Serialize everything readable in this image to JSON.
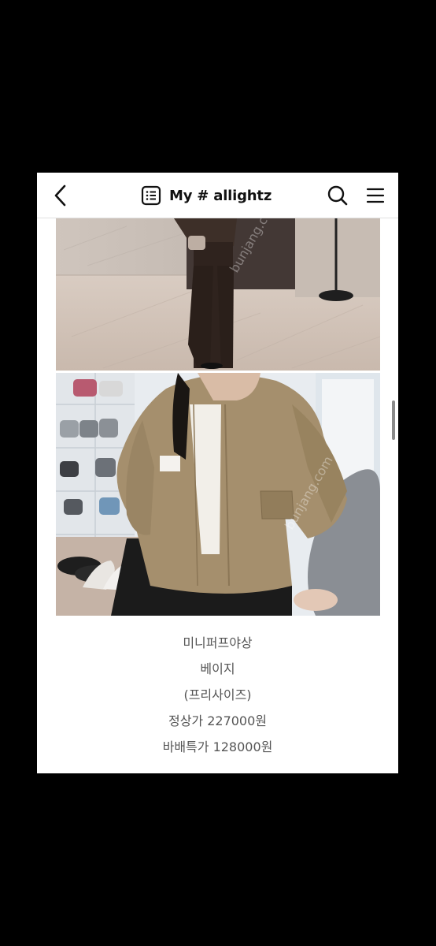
{
  "header": {
    "title": "My # allightz",
    "icons": {
      "back": "chevron-left-icon",
      "list": "list-icon",
      "search": "search-icon",
      "menu": "hamburger-menu-icon"
    }
  },
  "photos": [
    {
      "name": "product-photo-1",
      "alt": "model wearing dark outfit in marble lobby"
    },
    {
      "name": "product-photo-2",
      "alt": "model wearing beige jacket in shoe room"
    }
  ],
  "watermark": "bunjang",
  "description": {
    "name": "미니퍼프야상",
    "color": "베이지",
    "size": "(프리사이즈)",
    "regular_price": "정상가 227000원",
    "sale_price": "바배특가 128000원"
  },
  "colors": {
    "background": "#000000",
    "screen": "#ffffff",
    "text": "#555555",
    "title": "#111111"
  }
}
